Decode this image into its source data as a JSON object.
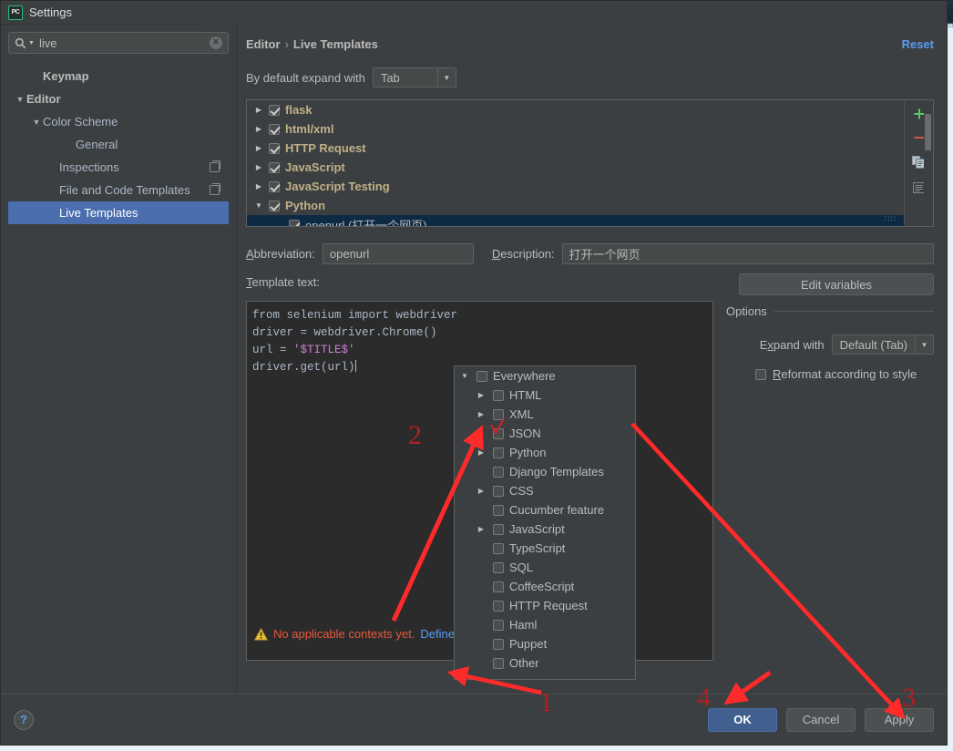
{
  "window": {
    "close_label": "x"
  },
  "dialog": {
    "title": "Settings",
    "logo_text": "PC"
  },
  "search": {
    "value": "live",
    "clear_label": "✕",
    "icon": "search-icon"
  },
  "sidebar": {
    "items": [
      {
        "label": "Keymap",
        "indent": 1,
        "twisty": "",
        "bold": true,
        "selected": false,
        "badge": false
      },
      {
        "label": "Editor",
        "indent": 0,
        "twisty": "▼",
        "bold": true,
        "selected": false,
        "badge": false
      },
      {
        "label": "Color Scheme",
        "indent": 1,
        "twisty": "▼",
        "bold": false,
        "selected": false,
        "badge": false
      },
      {
        "label": "General",
        "indent": 3,
        "twisty": "",
        "bold": false,
        "selected": false,
        "badge": false
      },
      {
        "label": "Inspections",
        "indent": 2,
        "twisty": "",
        "bold": false,
        "selected": false,
        "badge": true
      },
      {
        "label": "File and Code Templates",
        "indent": 2,
        "twisty": "",
        "bold": false,
        "selected": false,
        "badge": true
      },
      {
        "label": "Live Templates",
        "indent": 2,
        "twisty": "",
        "bold": false,
        "selected": true,
        "badge": false
      }
    ]
  },
  "content": {
    "breadcrumb_root": "Editor",
    "breadcrumb_sep": "›",
    "breadcrumb_leaf": "Live Templates",
    "reset_label": "Reset",
    "expand_label": "By default expand with",
    "expand_value": "Tab",
    "grip": "∷∷"
  },
  "templates": {
    "rows": [
      {
        "twisty": "▶",
        "checked": true,
        "label": "flask",
        "child": false,
        "selected": false
      },
      {
        "twisty": "▶",
        "checked": true,
        "label": "html/xml",
        "child": false,
        "selected": false
      },
      {
        "twisty": "▶",
        "checked": true,
        "label": "HTTP Request",
        "child": false,
        "selected": false
      },
      {
        "twisty": "▶",
        "checked": true,
        "label": "JavaScript",
        "child": false,
        "selected": false
      },
      {
        "twisty": "▶",
        "checked": true,
        "label": "JavaScript Testing",
        "child": false,
        "selected": false
      },
      {
        "twisty": "▼",
        "checked": true,
        "label": "Python",
        "child": false,
        "selected": false
      },
      {
        "twisty": "",
        "checked": true,
        "label": "openurl (打开一个网页)",
        "child": true,
        "selected": true
      }
    ],
    "toolbar": {
      "add": "add-icon",
      "remove": "remove-icon",
      "copy": "copy-icon",
      "duplicate": "document-icon"
    }
  },
  "details": {
    "abbreviation_label": "Abbreviation:",
    "abbreviation_value": "openurl",
    "description_label": "Description:",
    "description_value": "打开一个网页",
    "template_text_label": "Template text:",
    "edit_variables_label": "Edit variables",
    "code_lines": [
      "from selenium import webdriver",
      "driver = webdriver.Chrome()",
      "url = '$TITLE$'",
      "driver.get(url)"
    ],
    "code_line3_prefix": "url = ",
    "code_line3_string": "'$TITLE$'"
  },
  "options": {
    "title": "Options",
    "expand_with_label": "Expand with",
    "expand_with_value": "Default (Tab)",
    "reformat_label": "Reformat according to style",
    "reformat_checked": false
  },
  "context_popup": {
    "items": [
      {
        "label": "Everywhere",
        "level": 0,
        "twisty": "▼",
        "checked": false
      },
      {
        "label": "HTML",
        "level": 1,
        "twisty": "▶",
        "checked": false
      },
      {
        "label": "XML",
        "level": 1,
        "twisty": "▶",
        "checked": false
      },
      {
        "label": "JSON",
        "level": 1,
        "twisty": "",
        "checked": false
      },
      {
        "label": "Python",
        "level": 1,
        "twisty": "▶",
        "checked": false
      },
      {
        "label": "Django Templates",
        "level": 1,
        "twisty": "",
        "checked": false
      },
      {
        "label": "CSS",
        "level": 1,
        "twisty": "▶",
        "checked": false
      },
      {
        "label": "Cucumber feature",
        "level": 1,
        "twisty": "",
        "checked": false
      },
      {
        "label": "JavaScript",
        "level": 1,
        "twisty": "▶",
        "checked": false
      },
      {
        "label": "TypeScript",
        "level": 1,
        "twisty": "",
        "checked": false
      },
      {
        "label": "SQL",
        "level": 1,
        "twisty": "",
        "checked": false
      },
      {
        "label": "CoffeeScript",
        "level": 1,
        "twisty": "",
        "checked": false
      },
      {
        "label": "HTTP Request",
        "level": 1,
        "twisty": "",
        "checked": false
      },
      {
        "label": "Haml",
        "level": 1,
        "twisty": "",
        "checked": false
      },
      {
        "label": "Puppet",
        "level": 1,
        "twisty": "",
        "checked": false
      },
      {
        "label": "Other",
        "level": 1,
        "twisty": "",
        "checked": false
      }
    ]
  },
  "warning": {
    "icon": "warning-icon",
    "text": "No applicable contexts yet.",
    "link": "Define"
  },
  "bottom": {
    "help_label": "?",
    "ok_label": "OK",
    "cancel_label": "Cancel",
    "apply_label": "Apply"
  },
  "annotations": {
    "marks": [
      "1",
      "2",
      "3",
      "4"
    ],
    "color": "#ff2a2a"
  },
  "colors": {
    "accent_blue": "#4b6eaf",
    "link_blue": "#589df6",
    "warning_red": "#e8583a",
    "bold_yellow": "#c0b089",
    "annotation_red": "#ff2a2a"
  }
}
